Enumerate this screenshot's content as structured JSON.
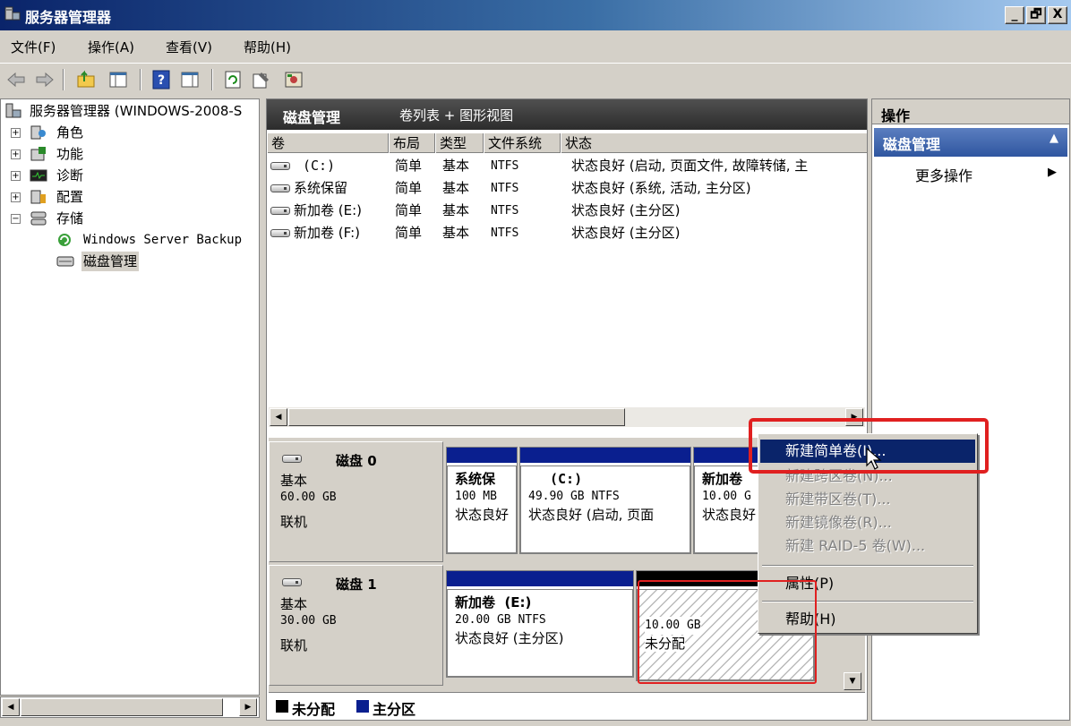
{
  "window": {
    "title": "服务器管理器",
    "caption_buttons": [
      "_",
      "🗗",
      "X"
    ]
  },
  "menu": [
    "文件(F)",
    "操作(A)",
    "查看(V)",
    "帮助(H)"
  ],
  "tree": {
    "root": "服务器管理器 (WINDOWS-2008-S",
    "items": [
      {
        "label": "角色",
        "expander": "+"
      },
      {
        "label": "功能",
        "expander": "+"
      },
      {
        "label": "诊断",
        "expander": "+"
      },
      {
        "label": "配置",
        "expander": "+"
      },
      {
        "label": "存储",
        "expander": "−"
      }
    ],
    "children": [
      "Windows Server Backup",
      "磁盘管理"
    ]
  },
  "center": {
    "title": "磁盘管理",
    "view": "卷列表 + 图形视图",
    "columns": [
      "卷",
      "布局",
      "类型",
      "文件系统",
      "状态"
    ],
    "rows": [
      {
        "vol": "(C:)",
        "layout": "简单",
        "type": "基本",
        "fs": "NTFS",
        "status": "状态良好 (启动, 页面文件, 故障转储, 主"
      },
      {
        "vol": "系统保留",
        "layout": "简单",
        "type": "基本",
        "fs": "NTFS",
        "status": "状态良好 (系统, 活动, 主分区)"
      },
      {
        "vol": "新加卷 (E:)",
        "layout": "简单",
        "type": "基本",
        "fs": "NTFS",
        "status": "状态良好 (主分区)"
      },
      {
        "vol": "新加卷 (F:)",
        "layout": "简单",
        "type": "基本",
        "fs": "NTFS",
        "status": "状态良好 (主分区)"
      }
    ]
  },
  "disks": [
    {
      "name": "磁盘 0",
      "type": "基本",
      "size": "60.00 GB",
      "state": "联机",
      "partitions": [
        {
          "name": "系统保",
          "size": "100 MB",
          "status": "状态良好"
        },
        {
          "name": "(C:)",
          "size": "49.90 GB NTFS",
          "status": "状态良好 (启动, 页面"
        },
        {
          "name": "新加卷",
          "size": "10.00 G",
          "status": "状态良好"
        }
      ]
    },
    {
      "name": "磁盘 1",
      "type": "基本",
      "size": "30.00 GB",
      "state": "联机",
      "partitions": [
        {
          "name": "新加卷  (E:)",
          "size": "20.00 GB NTFS",
          "status": "状态良好 (主分区)"
        },
        {
          "name": "",
          "size": "10.00 GB",
          "status": "未分配"
        }
      ]
    }
  ],
  "legend": {
    "unallocated": "未分配",
    "primary": "主分区"
  },
  "colors": {
    "primary": "#0a1f8f",
    "unallocated": "#000000",
    "selection": "#0a246a",
    "highlight": "#e02020"
  },
  "actions": {
    "header": "操作",
    "section": "磁盘管理",
    "more": "更多操作"
  },
  "context_menu": {
    "items": [
      {
        "label": "新建简单卷(I)...",
        "state": "selected"
      },
      {
        "label": "新建跨区卷(N)...",
        "state": "disabled"
      },
      {
        "label": "新建带区卷(T)...",
        "state": "disabled"
      },
      {
        "label": "新建镜像卷(R)...",
        "state": "disabled"
      },
      {
        "label": "新建 RAID-5 卷(W)...",
        "state": "disabled"
      }
    ],
    "properties": "属性(P)",
    "help": "帮助(H)"
  }
}
